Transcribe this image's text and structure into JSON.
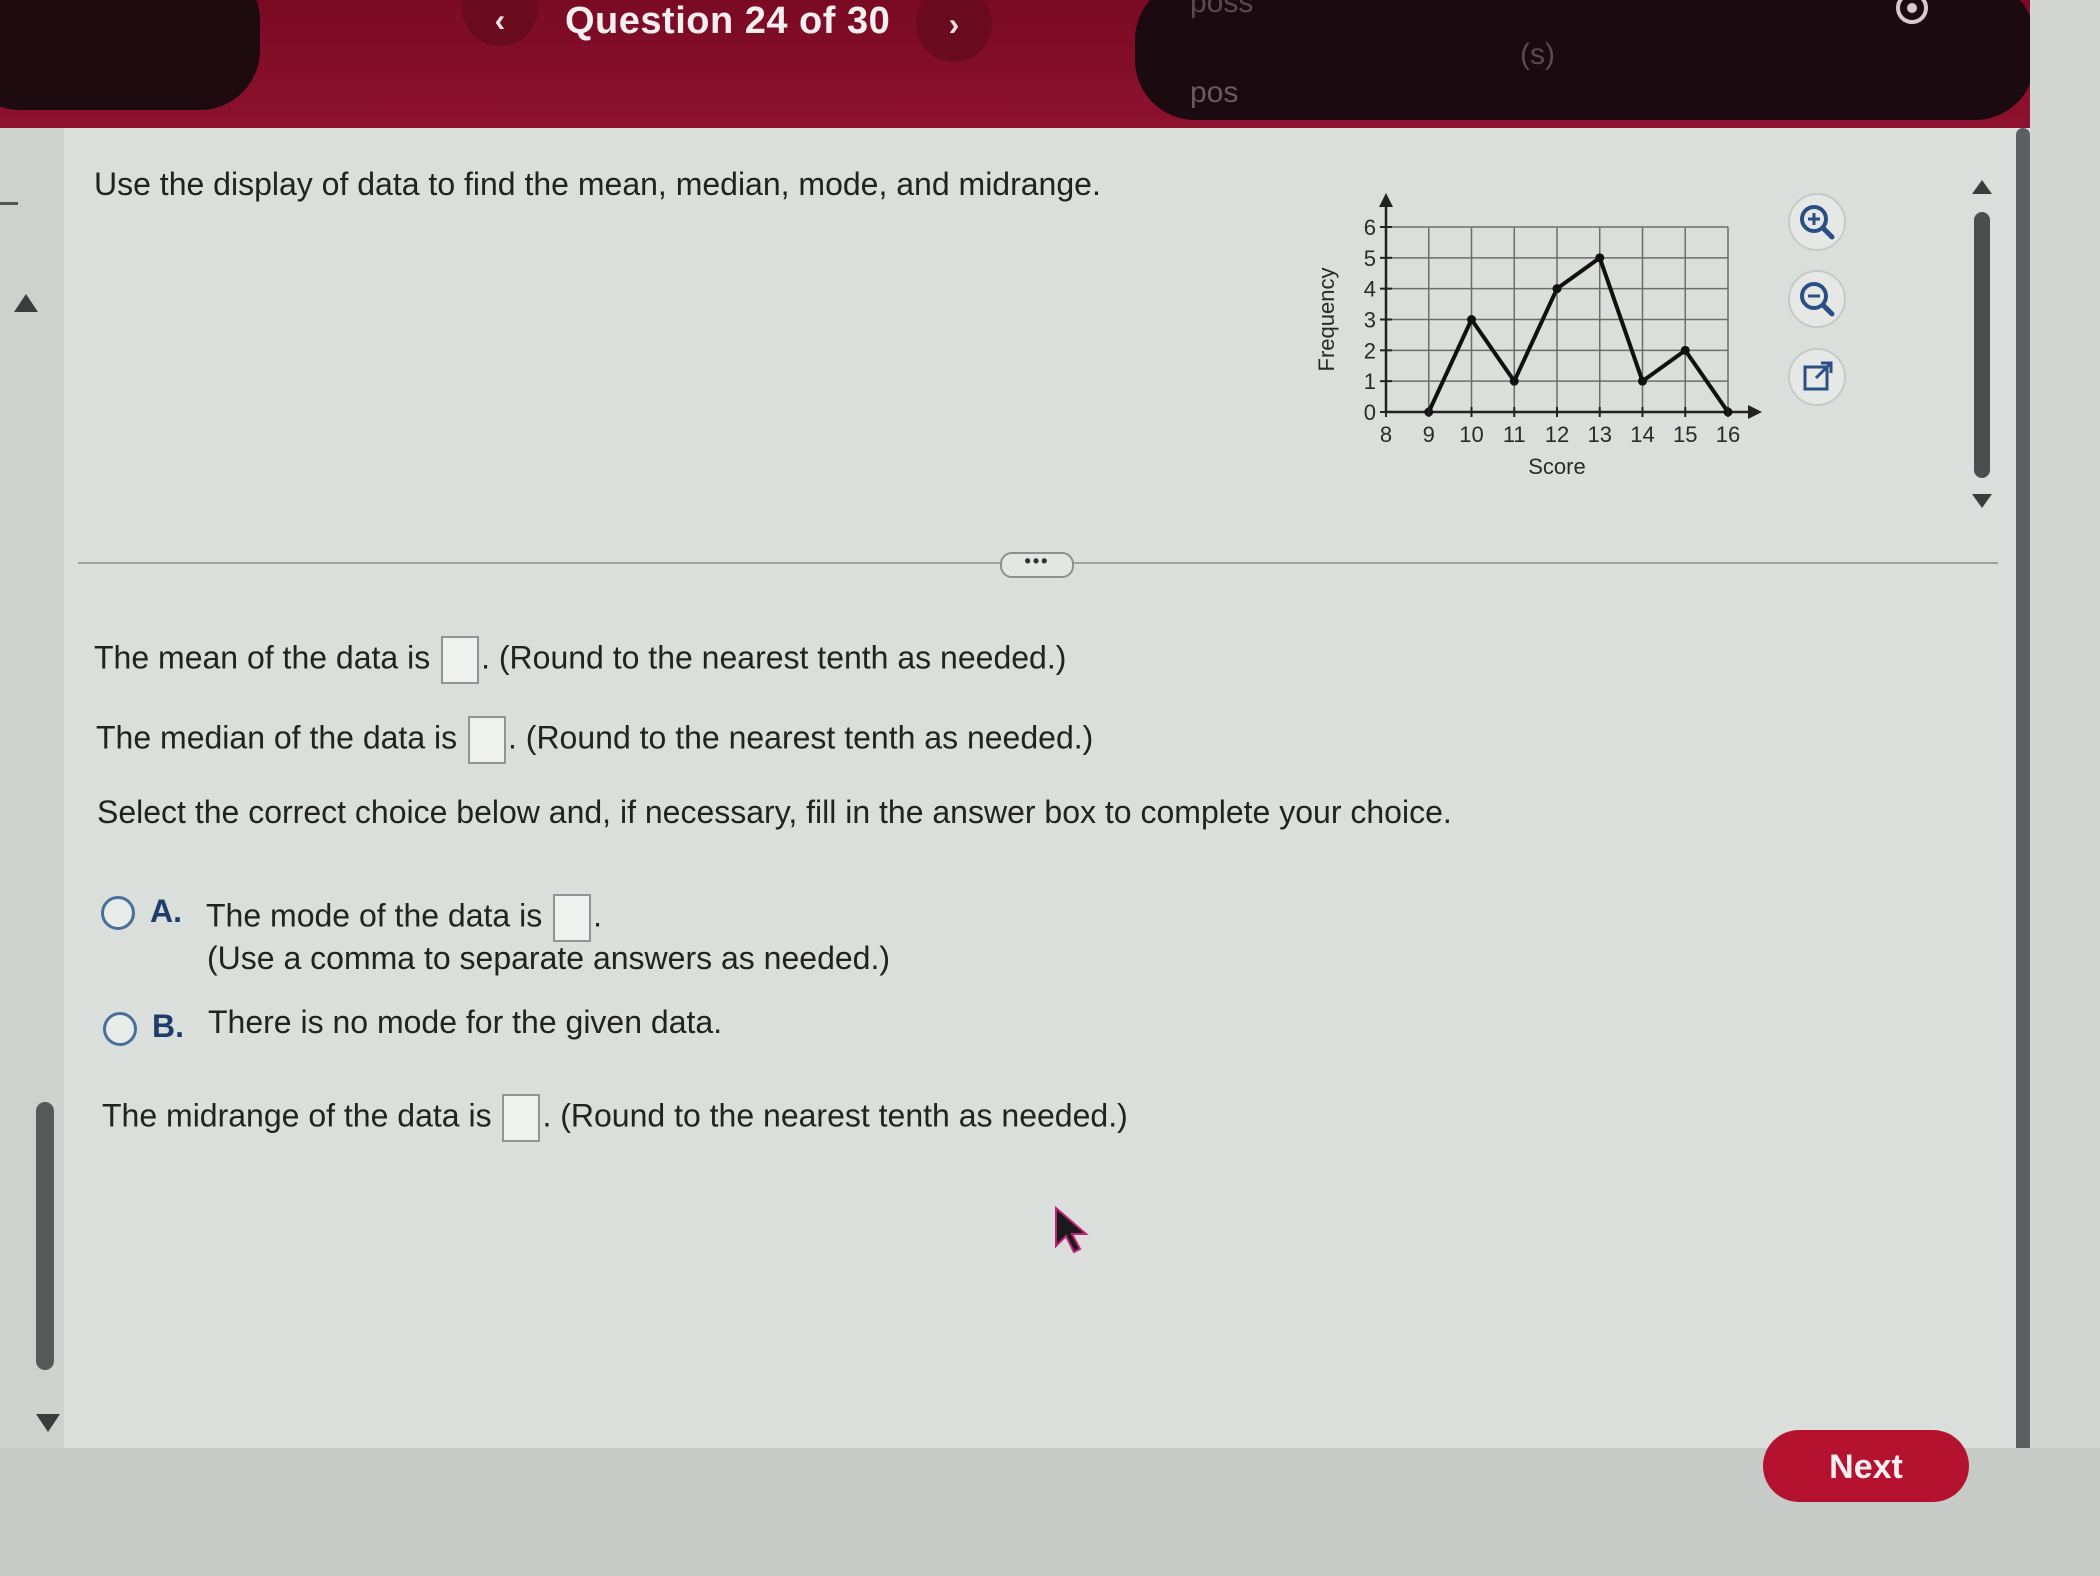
{
  "header": {
    "question_title": "Question 24 of 30",
    "prev_symbol": "‹",
    "next_symbol": "›",
    "faint_text_1": "poss",
    "faint_text_2": "pos",
    "faint_text_3": "(s)"
  },
  "instruction": "Use the display of data to find the mean, median, mode, and midrange.",
  "expand_label": "•••",
  "questions": {
    "mean_prefix": "The mean of the data is",
    "mean_suffix": ". (Round to the nearest tenth as needed.)",
    "median_prefix": "The median of the data is",
    "median_suffix": ". (Round to the nearest tenth as needed.)",
    "select_prompt": "Select the correct choice below and, if necessary, fill in the answer box to complete your choice.",
    "choice_a_letter": "A.",
    "choice_a_text": "The mode of the data is",
    "choice_a_suffix": ".",
    "choice_a_note": "(Use a comma to separate answers as needed.)",
    "choice_b_letter": "B.",
    "choice_b_text": "There is no mode for the given data.",
    "midrange_prefix": "The midrange of the data is",
    "midrange_suffix": ". (Round to the nearest tenth as needed.)"
  },
  "tools": [
    "zoom-in-icon",
    "zoom-out-icon",
    "open-new-window-icon"
  ],
  "footer": {
    "next_label": "Next"
  },
  "colors": {
    "header": "#8d1230",
    "next_button": "#b5122f",
    "radio": "#4a6f9a"
  },
  "chart_data": {
    "type": "line",
    "x": [
      8,
      9,
      10,
      11,
      12,
      13,
      14,
      15,
      16
    ],
    "series": [
      {
        "values": [
          0,
          0,
          3,
          1,
          4,
          5,
          1,
          2,
          0
        ]
      }
    ],
    "xlabel": "Score",
    "ylabel": "Frequency",
    "xlim": [
      8,
      16
    ],
    "ylim": [
      0,
      6
    ],
    "x_ticks": [
      "8",
      "9",
      "10",
      "11",
      "12",
      "13",
      "14",
      "15",
      "16"
    ],
    "y_ticks": [
      "0",
      "1",
      "2",
      "3",
      "4",
      "5",
      "6"
    ],
    "grid": true
  }
}
